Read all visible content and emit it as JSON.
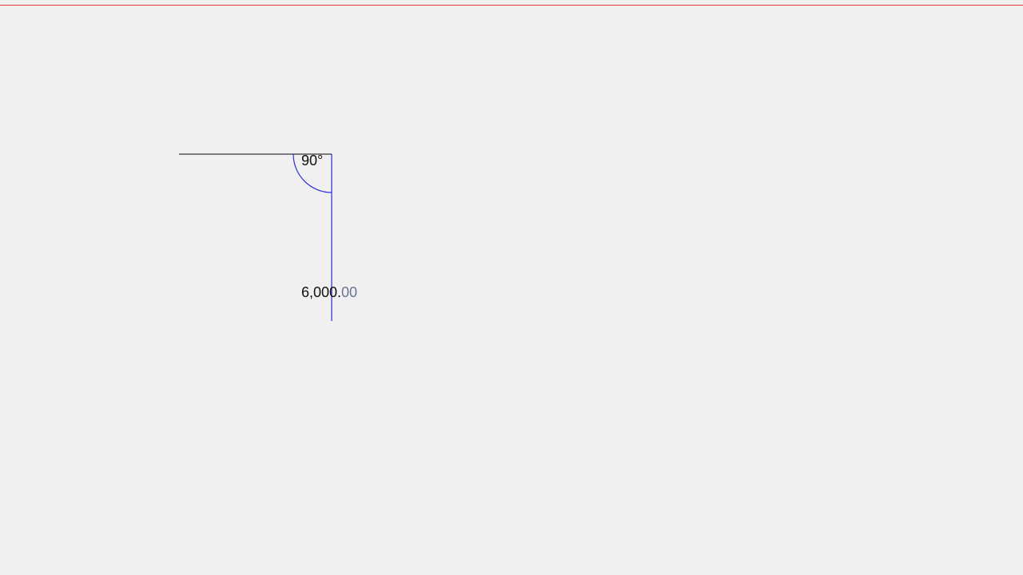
{
  "canvas": {
    "background_color": "#f0f0f0",
    "guide_line_color": "#e53935",
    "wall_line_color": "#555555",
    "active_line_color": "#2b2bd8"
  },
  "measurements": {
    "angle_label": "90°",
    "length_integer": "6,000.",
    "length_fraction": "00"
  }
}
